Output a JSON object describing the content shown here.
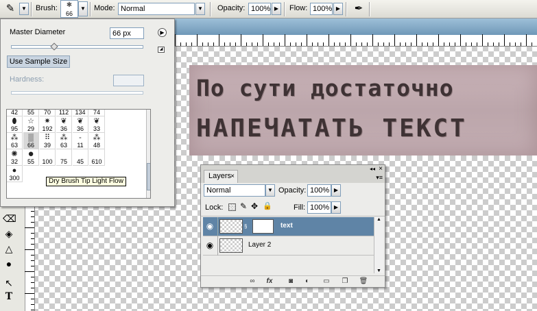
{
  "options_bar": {
    "brush_label": "Brush:",
    "brush_size": "66",
    "mode_label": "Mode:",
    "mode_value": "Normal",
    "opacity_label": "Opacity:",
    "opacity_value": "100%",
    "flow_label": "Flow:",
    "flow_value": "100%"
  },
  "brush_picker": {
    "master_diameter_label": "Master Diameter",
    "master_diameter_value": "66 px",
    "use_sample_size_label": "Use Sample Size",
    "hardness_label": "Hardness:",
    "presets": [
      {
        "size": "42",
        "icon": "soft-round"
      },
      {
        "size": "55",
        "icon": "soft-round"
      },
      {
        "size": "70",
        "icon": "soft-round"
      },
      {
        "size": "112",
        "icon": "soft-round"
      },
      {
        "size": "134",
        "icon": "soft-round"
      },
      {
        "size": "74",
        "icon": "soft-round"
      },
      {
        "size": "95",
        "icon": "drop"
      },
      {
        "size": "29",
        "icon": "star"
      },
      {
        "size": "192",
        "icon": "starburst"
      },
      {
        "size": "36",
        "icon": "leaf"
      },
      {
        "size": "36",
        "icon": "leaf"
      },
      {
        "size": "33",
        "icon": "leaf"
      },
      {
        "size": "63",
        "icon": "scatter"
      },
      {
        "size": "66",
        "icon": "dry-brush"
      },
      {
        "size": "39",
        "icon": "dots"
      },
      {
        "size": "63",
        "icon": "scatter"
      },
      {
        "size": "11",
        "icon": "line"
      },
      {
        "size": "48",
        "icon": "scatter"
      },
      {
        "size": "32",
        "icon": "splatter"
      },
      {
        "size": "55",
        "icon": "hard-round"
      },
      {
        "size": "100",
        "icon": "blank"
      },
      {
        "size": "75",
        "icon": "blank"
      },
      {
        "size": "45",
        "icon": "blank"
      },
      {
        "size": "610",
        "icon": "blank"
      },
      {
        "size": "300",
        "icon": "blob"
      }
    ],
    "tooltip": "Dry Brush Tip Light Flow"
  },
  "canvas": {
    "line1": "По сути достаточно",
    "line2": "НАПЕЧАТАТЬ ТЕКСТ"
  },
  "layers_panel": {
    "tab_label": "Layers",
    "blend_mode": "Normal",
    "opacity_label": "Opacity:",
    "opacity_value": "100%",
    "lock_label": "Lock:",
    "fill_label": "Fill:",
    "fill_value": "100%",
    "layers": [
      {
        "name": "text",
        "selected": true,
        "has_mask": true
      },
      {
        "name": "Layer 2",
        "selected": false,
        "has_mask": false
      }
    ]
  },
  "colors": {
    "selected_layer": "#5f84a6",
    "title_bar": "#7fa6c4"
  }
}
